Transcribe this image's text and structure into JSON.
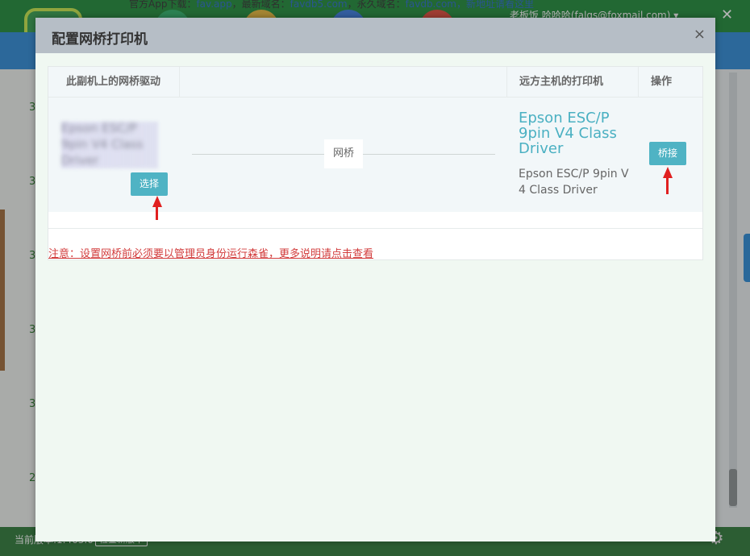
{
  "background": {
    "notice_prefix": "官方App下载：",
    "notice_link1": "fav.app",
    "notice_mid": "，最新域名：",
    "notice_link2": "favdb5.com",
    "notice_mid2": "，永久域名：",
    "notice_link3": "favdb.com",
    "notice_suffix": "，新地址请看这里",
    "user": "老板饭 哈哈哈(falgs@foxmail.com) ▾",
    "list_numbers": [
      "3",
      "3",
      "3",
      "3",
      "3",
      "3",
      "2"
    ],
    "version": "当前版本:1.463.0",
    "check_update": "检查新版本"
  },
  "modal": {
    "title": "配置网桥打印机",
    "close": "×",
    "table": {
      "col_local": "此副机上的网桥驱动",
      "col_remote": "远方主机的打印机",
      "col_action": "操作"
    },
    "row": {
      "local_driver_obscured": "Epson ESC/P 9pin V4 Class Driver",
      "select_button": "选择",
      "bridge_label": "网桥",
      "remote_printer": "Epson ESC/P 9pin V4 Class Driver",
      "remote_printer_sub": "Epson ESC/P 9pin V 4 Class Driver",
      "bridge_button": "桥接"
    },
    "notice": "注意：设置网桥前必须要以管理员身份运行森雀，更多说明请点击查看"
  },
  "colors": {
    "accent": "#4fb3c4",
    "notice": "#d23c3c",
    "arrow": "#e02020",
    "topbar": "#1f8b3a"
  }
}
